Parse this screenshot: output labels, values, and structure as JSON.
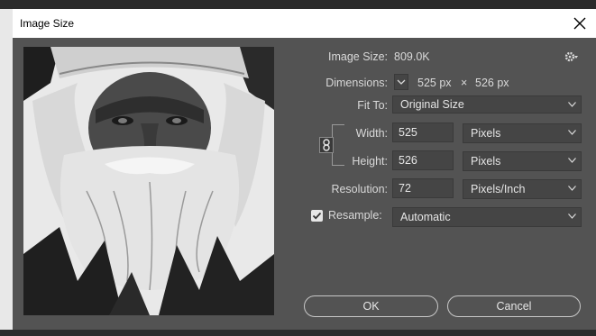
{
  "window": {
    "title": "Image Size"
  },
  "image_size": {
    "label": "Image Size:",
    "value": "809.0K"
  },
  "dimensions": {
    "label": "Dimensions:",
    "width_text": "525 px",
    "times": "×",
    "height_text": "526 px"
  },
  "fit_to": {
    "label": "Fit To:",
    "value": "Original Size"
  },
  "width": {
    "label": "Width:",
    "value": "525",
    "unit": "Pixels"
  },
  "height": {
    "label": "Height:",
    "value": "526",
    "unit": "Pixels"
  },
  "resolution": {
    "label": "Resolution:",
    "value": "72",
    "unit": "Pixels/Inch"
  },
  "resample": {
    "label": "Resample:",
    "checked": true,
    "value": "Automatic"
  },
  "buttons": {
    "ok": "OK",
    "cancel": "Cancel"
  },
  "icons": {
    "close": "close-icon",
    "gear": "gear-icon",
    "chain": "chain-link-icon",
    "checkbox": "checkbox-check-icon"
  },
  "colors": {
    "dialog_bg": "#535353",
    "field_bg": "#454545",
    "text": "#d9d9d9",
    "titlebar": "#ffffff"
  }
}
